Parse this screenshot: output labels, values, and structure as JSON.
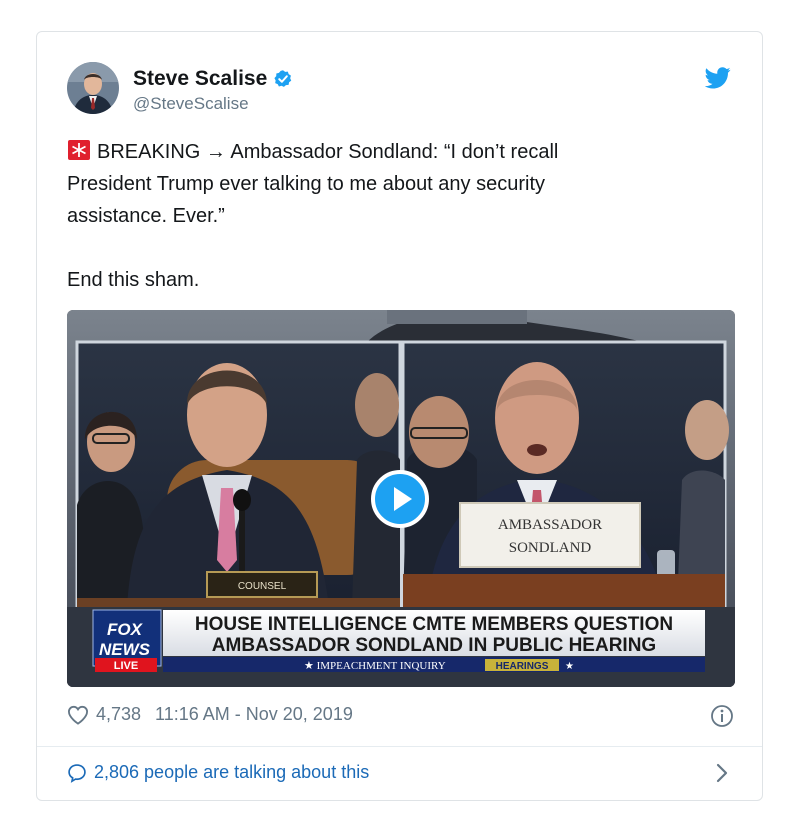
{
  "tweet": {
    "author_name": "Steve Scalise",
    "author_handle": "@SteveScalise",
    "line_1": "BREAKING → Ambassador Sondland: “I don’t recall",
    "line_2": "President Trump ever talking to me about any security",
    "line_3": "assistance. Ever.”",
    "line_4": "End this sham."
  },
  "media": {
    "counsel_plate": "COUNSEL",
    "nameplate_line_1": "AMBASSADOR",
    "nameplate_line_2": "SONDLAND",
    "logo_line_1": "FOX",
    "logo_line_2": "NEWS",
    "logo_live": "LIVE",
    "headline_line_1": "HOUSE INTELLIGENCE CMTE MEMBERS QUESTION",
    "headline_line_2": "AMBASSADOR SONDLAND IN PUBLIC HEARING",
    "ticker_label": "★ IMPEACHMENT INQUIRY",
    "ticker_badge": "HEARINGS",
    "ticker_star": "★"
  },
  "footer": {
    "likes": "4,738",
    "time": "11:16 AM - Nov 20, 2019",
    "talking": "2,806 people are talking about this"
  },
  "icons": {
    "verified": "verified-badge-icon",
    "twitter": "twitter-bird-icon",
    "siren": "rotating-light-icon",
    "play": "play-icon",
    "like": "heart-icon",
    "info": "info-icon",
    "reply": "speech-bubble-icon",
    "chevron": "chevron-right-icon"
  },
  "colors": {
    "twitter_blue": "#1da1f2",
    "link_blue": "#1b6ab7",
    "text": "#14171a",
    "muted": "#657786"
  }
}
